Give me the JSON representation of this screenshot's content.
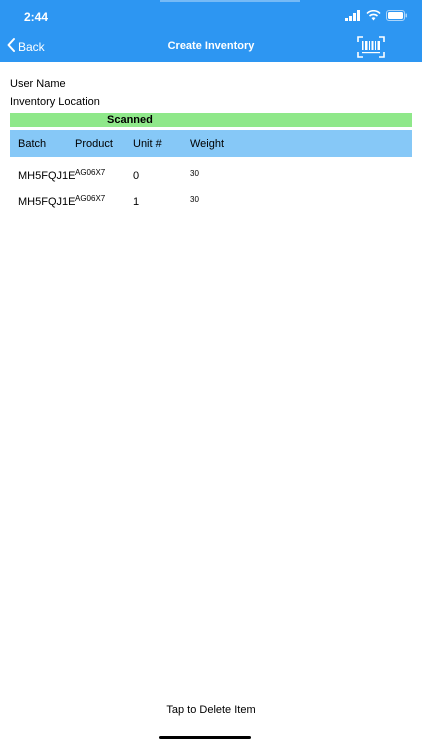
{
  "status_bar": {
    "time": "2:44",
    "icons": [
      "cellular-icon",
      "wifi-icon",
      "battery-icon"
    ]
  },
  "nav": {
    "back_label": "Back",
    "title": "Create Inventory",
    "scan_icon": "barcode-scan-icon"
  },
  "info": {
    "user_name_label": "User Name",
    "inventory_location_label": "Inventory Location"
  },
  "scanned_label": "Scanned",
  "table": {
    "headers": [
      "Batch",
      "Product",
      "Unit #",
      "Weight"
    ],
    "rows": [
      {
        "batch": "MH5FQJ1E",
        "product": "AG06X7",
        "unit": "0",
        "weight": "30"
      },
      {
        "batch": "MH5FQJ1E",
        "product": "AG06X7",
        "unit": "1",
        "weight": "30"
      }
    ]
  },
  "footer": {
    "action_label": "Tap to Delete Item"
  },
  "colors": {
    "nav_background": "#2d96f2",
    "scanned_bar": "#8fe88a",
    "table_header": "#86c8f7"
  }
}
